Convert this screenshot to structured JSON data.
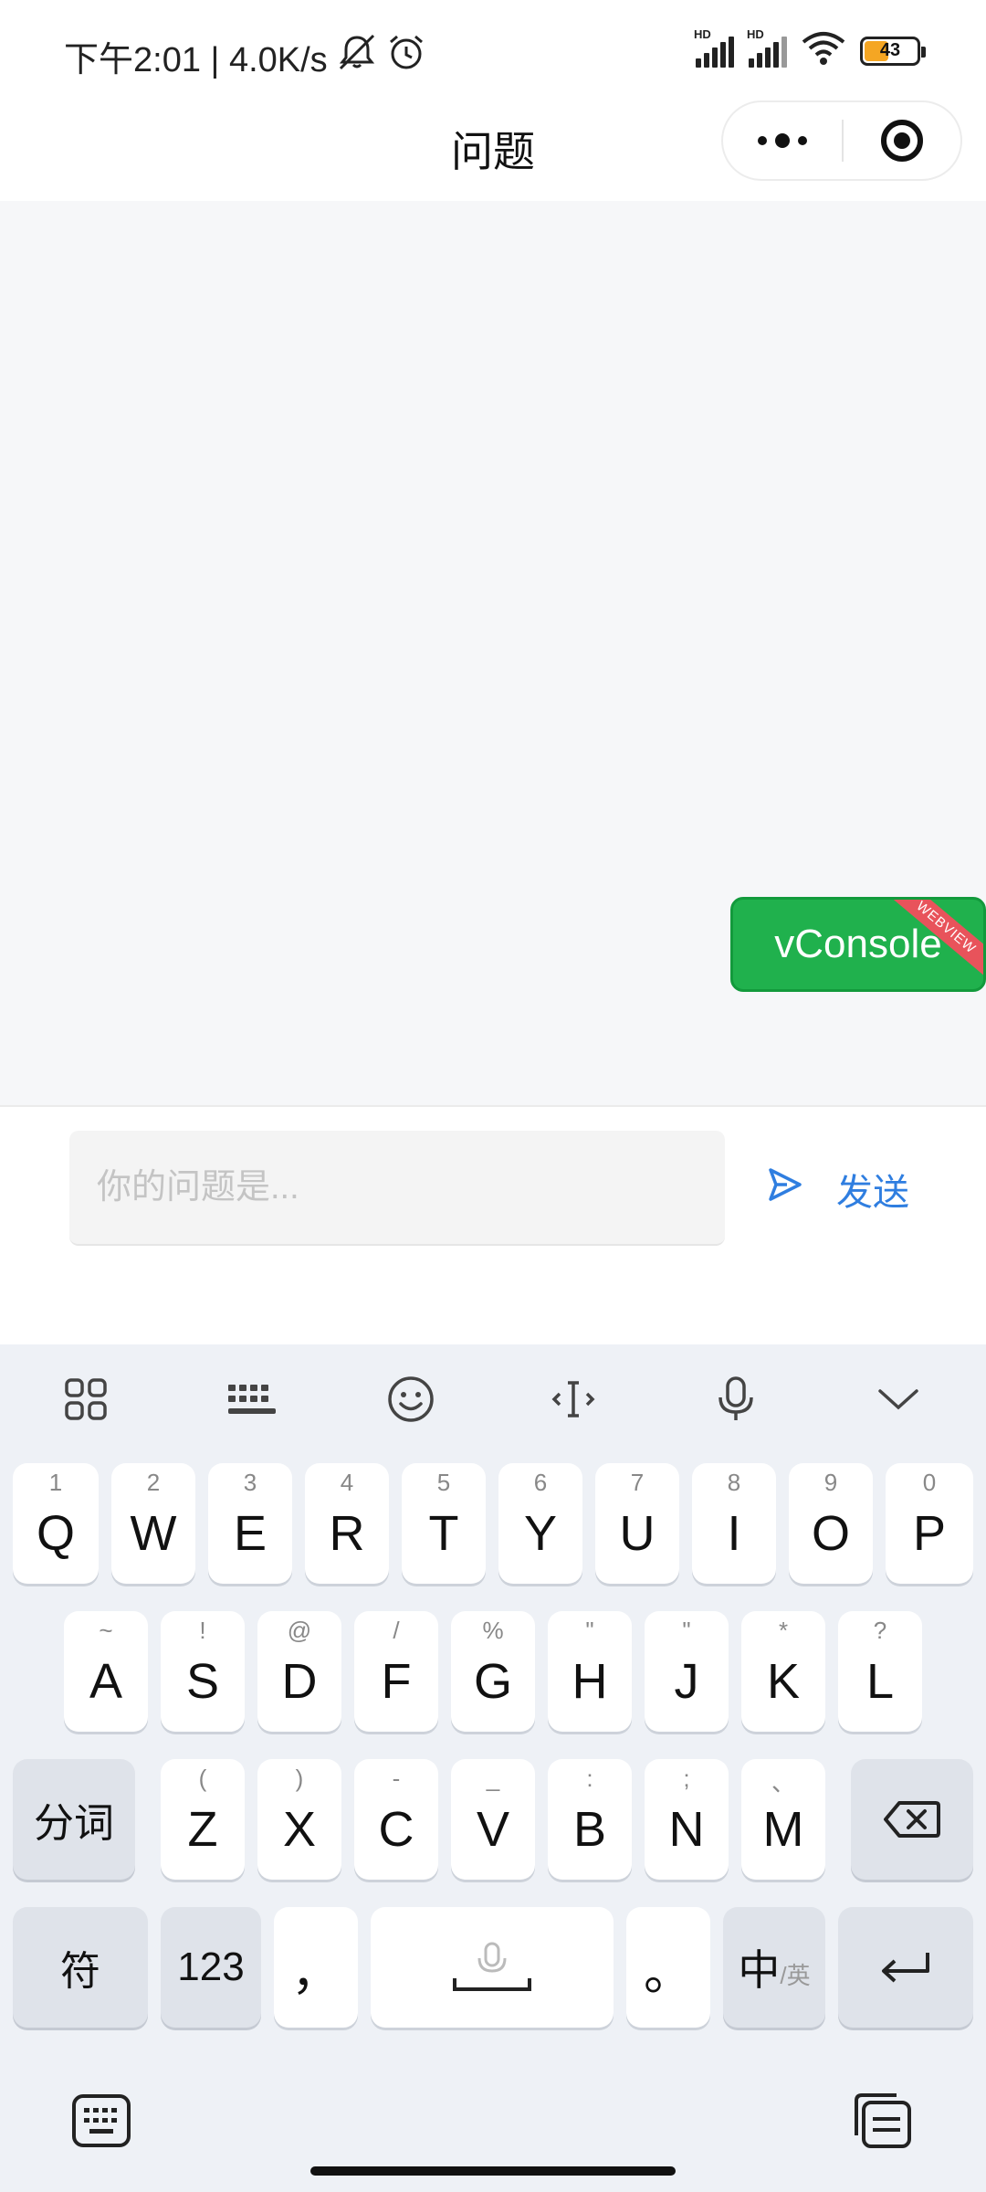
{
  "status_bar": {
    "time_speed": "下午2:01 | 4.0K/s",
    "signal_label_1": "HD",
    "signal_label_2": "HD",
    "battery": "43"
  },
  "nav": {
    "title": "问题"
  },
  "vconsole": {
    "label": "vConsole",
    "ribbon": "WEBVIEW"
  },
  "input": {
    "placeholder": "你的问题是...",
    "value": ""
  },
  "send": {
    "label": "发送"
  },
  "keyboard": {
    "row1": [
      {
        "hint": "1",
        "key": "Q"
      },
      {
        "hint": "2",
        "key": "W"
      },
      {
        "hint": "3",
        "key": "E"
      },
      {
        "hint": "4",
        "key": "R"
      },
      {
        "hint": "5",
        "key": "T"
      },
      {
        "hint": "6",
        "key": "Y"
      },
      {
        "hint": "7",
        "key": "U"
      },
      {
        "hint": "8",
        "key": "I"
      },
      {
        "hint": "9",
        "key": "O"
      },
      {
        "hint": "0",
        "key": "P"
      }
    ],
    "row2": [
      {
        "hint": "~",
        "key": "A"
      },
      {
        "hint": "!",
        "key": "S"
      },
      {
        "hint": "@",
        "key": "D"
      },
      {
        "hint": "/",
        "key": "F"
      },
      {
        "hint": "%",
        "key": "G"
      },
      {
        "hint": "\"",
        "key": "H"
      },
      {
        "hint": "\"",
        "key": "J"
      },
      {
        "hint": "*",
        "key": "K"
      },
      {
        "hint": "?",
        "key": "L"
      }
    ],
    "row3": [
      {
        "hint": "(",
        "key": "Z"
      },
      {
        "hint": ")",
        "key": "X"
      },
      {
        "hint": "-",
        "key": "C"
      },
      {
        "hint": "_",
        "key": "V"
      },
      {
        "hint": ":",
        "key": "B"
      },
      {
        "hint": ";",
        "key": "N"
      },
      {
        "hint": "、",
        "key": "M"
      }
    ],
    "segment_label": "分词",
    "symbol_label": "符",
    "numbers_label": "123",
    "comma_label": "，",
    "period_label": "。",
    "lang_main": "中",
    "lang_alt": "/英"
  },
  "icons": {
    "toolbar": [
      "apps-grid-icon",
      "keyboard-layout-icon",
      "emoji-icon",
      "text-cursor-icon",
      "microphone-icon",
      "collapse-chevron-icon"
    ],
    "bottom_left": "keyboard-switch-icon",
    "bottom_right": "clipboard-icon"
  },
  "colors": {
    "accent_blue": "#2f7ee0",
    "vconsole_green": "#20b14d",
    "ribbon_red": "#e8535b",
    "battery_fill": "#f5a623"
  }
}
